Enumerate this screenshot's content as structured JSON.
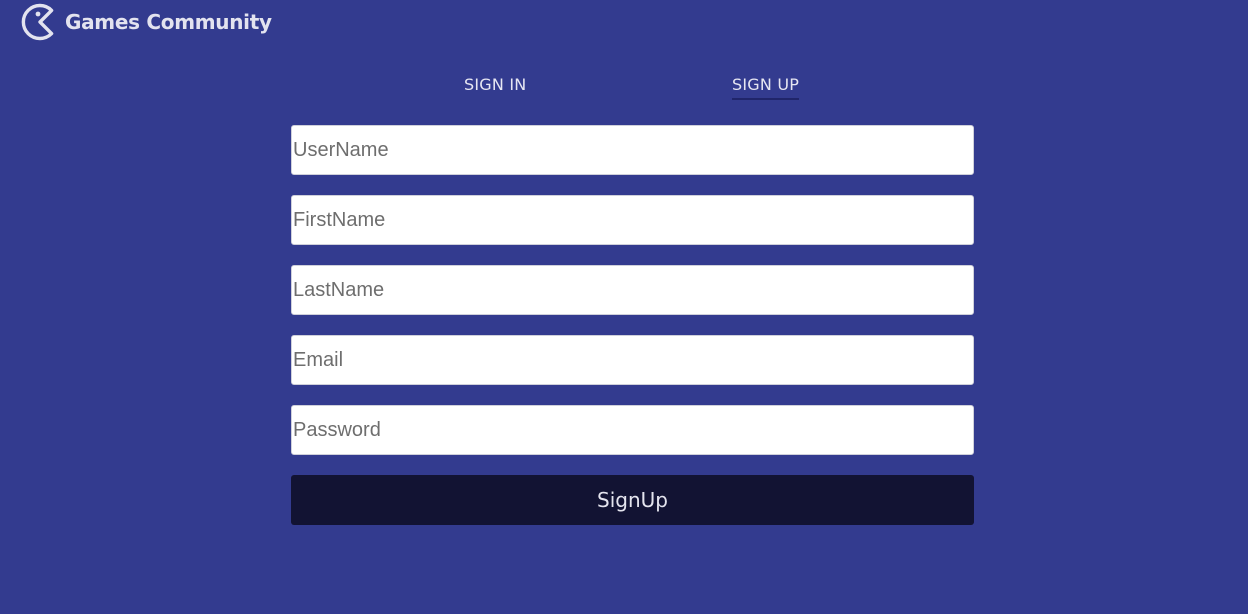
{
  "header": {
    "brand_name": "Games Community",
    "brand_icon": "pacman-icon"
  },
  "tabs": [
    {
      "label": "SIGN IN",
      "active": false
    },
    {
      "label": "SIGN UP",
      "active": true
    }
  ],
  "form": {
    "fields": [
      {
        "name": "username",
        "value": "",
        "placeholder": "UserName"
      },
      {
        "name": "firstname",
        "value": "",
        "placeholder": "FirstName"
      },
      {
        "name": "lastname",
        "value": "",
        "placeholder": "LastName"
      },
      {
        "name": "email",
        "value": "",
        "placeholder": "Email"
      },
      {
        "name": "password",
        "value": "",
        "placeholder": "Password"
      }
    ],
    "submit_label": "SignUp"
  },
  "colors": {
    "background": "#333b8f",
    "button": "#121333",
    "active_tab_underline": "#20256a",
    "text_light": "#e6e6f2"
  }
}
